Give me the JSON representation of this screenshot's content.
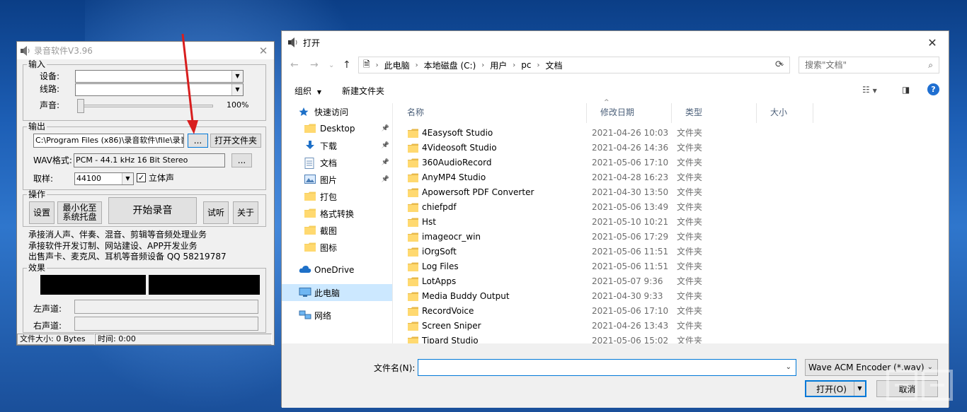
{
  "recorder": {
    "title": "录音软件V3.96",
    "input_group": {
      "label": "输入",
      "device_label": "设备:",
      "device_value": "",
      "line_label": "线路:",
      "line_value": "",
      "volume_label": "声音:",
      "volume_value": "100%",
      "volume_level": 0
    },
    "output_group": {
      "label": "输出",
      "path_value": "C:\\Program Files (x86)\\录音软件\\file\\录音",
      "browse_label": "...",
      "open_folder_label": "打开文件夹",
      "wav_label": "WAV格式:",
      "wav_value": "PCM - 44.1 kHz 16 Bit Stereo",
      "wav_browse_label": "...",
      "sample_label": "取样:",
      "sample_value": "44100",
      "stereo_label": "立体声",
      "stereo_checked": true
    },
    "ops_group": {
      "label": "操作",
      "settings_label": "设置",
      "minimize_line1": "最小化至",
      "minimize_line2": "系统托盘",
      "start_label": "开始录音",
      "listen_label": "试听",
      "about_label": "关于"
    },
    "info_lines": [
      "承接消人声、伴奏、混音、剪辑等音频处理业务",
      "承接软件开发订制、网站建设、APP开发业务",
      "出售声卡、麦克风、耳机等音频设备 QQ 58219787"
    ],
    "effect_group": {
      "label": "效果",
      "left_label": "左声道:",
      "right_label": "右声道:"
    },
    "status": {
      "file_size": "文件大小: 0 Bytes",
      "time": "时间: 0:00"
    }
  },
  "dialog": {
    "title": "打开",
    "path": [
      "此电脑",
      "本地磁盘 (C:)",
      "用户",
      "pc",
      "文档"
    ],
    "search_placeholder": "搜索\"文档\"",
    "organize_label": "组织",
    "new_folder_label": "新建文件夹",
    "nav_items": [
      {
        "label": "快速访问",
        "icon": "star-icon",
        "pinned": false
      },
      {
        "label": "Desktop",
        "icon": "folder-icon",
        "pinned": true
      },
      {
        "label": "下载",
        "icon": "download-icon",
        "pinned": true
      },
      {
        "label": "文档",
        "icon": "document-icon",
        "pinned": true
      },
      {
        "label": "图片",
        "icon": "picture-icon",
        "pinned": true
      },
      {
        "label": "打包",
        "icon": "folder-icon",
        "pinned": false
      },
      {
        "label": "格式转换",
        "icon": "folder-icon",
        "pinned": false
      },
      {
        "label": "截图",
        "icon": "folder-icon",
        "pinned": false
      },
      {
        "label": "图标",
        "icon": "folder-icon",
        "pinned": false
      },
      {
        "label": "OneDrive",
        "icon": "cloud-icon",
        "pinned": false
      },
      {
        "label": "此电脑",
        "icon": "computer-icon",
        "pinned": false,
        "selected": true
      },
      {
        "label": "网络",
        "icon": "network-icon",
        "pinned": false
      }
    ],
    "columns": [
      "名称",
      "修改日期",
      "类型",
      "大小"
    ],
    "files": [
      {
        "name": "4Easysoft Studio",
        "date": "2021-04-26 10:03",
        "type": "文件夹"
      },
      {
        "name": "4Videosoft Studio",
        "date": "2021-04-26 14:36",
        "type": "文件夹"
      },
      {
        "name": "360AudioRecord",
        "date": "2021-05-06 17:10",
        "type": "文件夹"
      },
      {
        "name": "AnyMP4 Studio",
        "date": "2021-04-28 16:23",
        "type": "文件夹"
      },
      {
        "name": "Apowersoft PDF Converter",
        "date": "2021-04-30 13:50",
        "type": "文件夹"
      },
      {
        "name": "chiefpdf",
        "date": "2021-05-06 13:49",
        "type": "文件夹"
      },
      {
        "name": "Hst",
        "date": "2021-05-10 10:21",
        "type": "文件夹"
      },
      {
        "name": "imageocr_win",
        "date": "2021-05-06 17:29",
        "type": "文件夹"
      },
      {
        "name": "iOrgSoft",
        "date": "2021-05-06 11:51",
        "type": "文件夹"
      },
      {
        "name": "Log Files",
        "date": "2021-05-06 11:51",
        "type": "文件夹"
      },
      {
        "name": "LotApps",
        "date": "2021-05-07 9:36",
        "type": "文件夹"
      },
      {
        "name": "Media Buddy Output",
        "date": "2021-04-30 9:33",
        "type": "文件夹"
      },
      {
        "name": "RecordVoice",
        "date": "2021-05-06 17:10",
        "type": "文件夹"
      },
      {
        "name": "Screen Sniper",
        "date": "2021-04-26 13:43",
        "type": "文件夹"
      },
      {
        "name": "Tipard Studio",
        "date": "2021-05-06 15:02",
        "type": "文件夹"
      }
    ],
    "filename_label": "文件名(N):",
    "filename_value": "",
    "filter_value": "Wave ACM Encoder (*.wav)",
    "open_label": "打开(O)",
    "cancel_label": "取消"
  },
  "colors": {
    "accent": "#0078d7",
    "folder": "#f6cf60",
    "selected_nav": "#cce8ff",
    "arrow": "#d81e1e"
  }
}
